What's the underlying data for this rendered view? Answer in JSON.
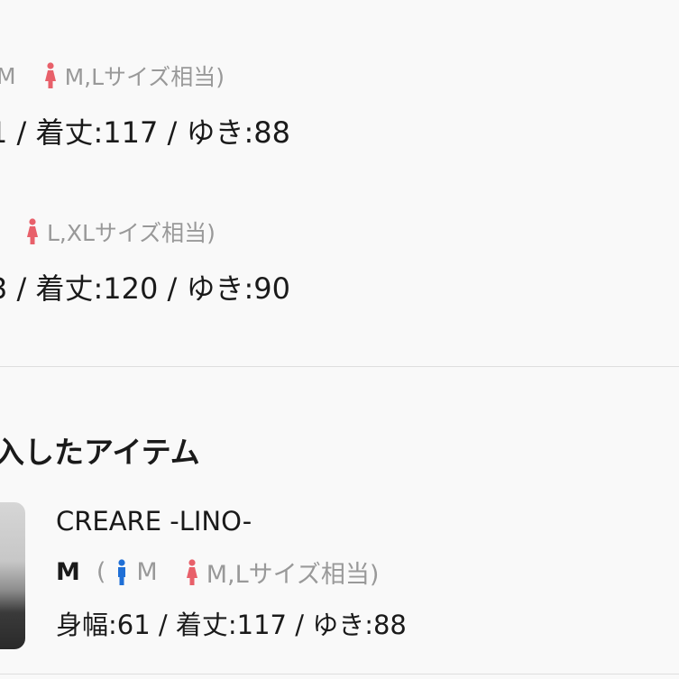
{
  "entries": [
    {
      "size_text": "M",
      "female_size": "M,Lサイズ相当)",
      "dims": "1 / 着丈:117 / ゆき:88"
    },
    {
      "female_size": "L,XLサイズ相当)",
      "dims": "3 / 着丈:120 / ゆき:90"
    }
  ],
  "purchased": {
    "title": "入したアイテム",
    "item": {
      "name": "CREARE -LINO-",
      "size_label": "M",
      "open_paren": "(",
      "male_size": "M",
      "female_size": "M,Lサイズ相当)",
      "dims": "身幅:61 / 着丈:117 / ゆき:88"
    }
  },
  "colors": {
    "male_icon": "#1f6fd6",
    "female_icon": "#e8606a",
    "muted_text": "#999999",
    "divider": "#dedede"
  }
}
